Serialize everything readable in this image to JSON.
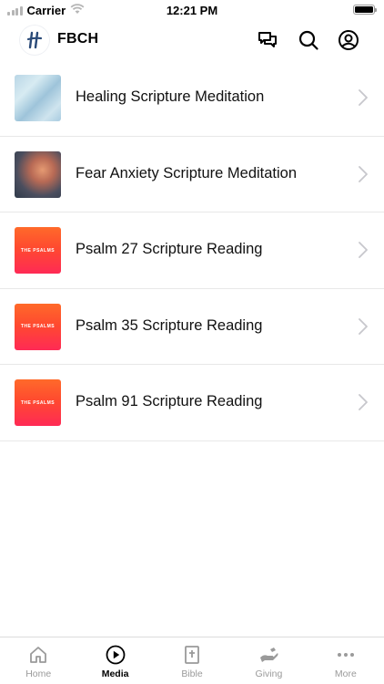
{
  "status_bar": {
    "carrier": "Carrier",
    "time": "12:21 PM"
  },
  "header": {
    "brand": "FBCH",
    "icons": [
      "chat-icon",
      "search-icon",
      "profile-icon"
    ]
  },
  "media_list": [
    {
      "title": "Healing Scripture Meditation",
      "thumb": "sky"
    },
    {
      "title": "Fear Anxiety Scripture Meditation",
      "thumb": "clouds"
    },
    {
      "title": "Psalm 27 Scripture Reading",
      "thumb": "psalms",
      "thumb_text": "THE PSALMS"
    },
    {
      "title": "Psalm 35 Scripture Reading",
      "thumb": "psalms",
      "thumb_text": "THE PSALMS"
    },
    {
      "title": "Psalm 91 Scripture Reading",
      "thumb": "psalms",
      "thumb_text": "THE PSALMS"
    }
  ],
  "tab_bar": {
    "active": "Media",
    "tabs": [
      {
        "label": "Home",
        "icon": "home-icon"
      },
      {
        "label": "Media",
        "icon": "play-icon"
      },
      {
        "label": "Bible",
        "icon": "bible-icon"
      },
      {
        "label": "Giving",
        "icon": "giving-icon"
      },
      {
        "label": "More",
        "icon": "more-icon"
      }
    ]
  },
  "colors": {
    "psalms_orange": "#ff5a2a",
    "psalms_pink": "#ff2a55",
    "inactive_tab": "#9a9a9a",
    "logo_blue": "#2a4a78"
  }
}
